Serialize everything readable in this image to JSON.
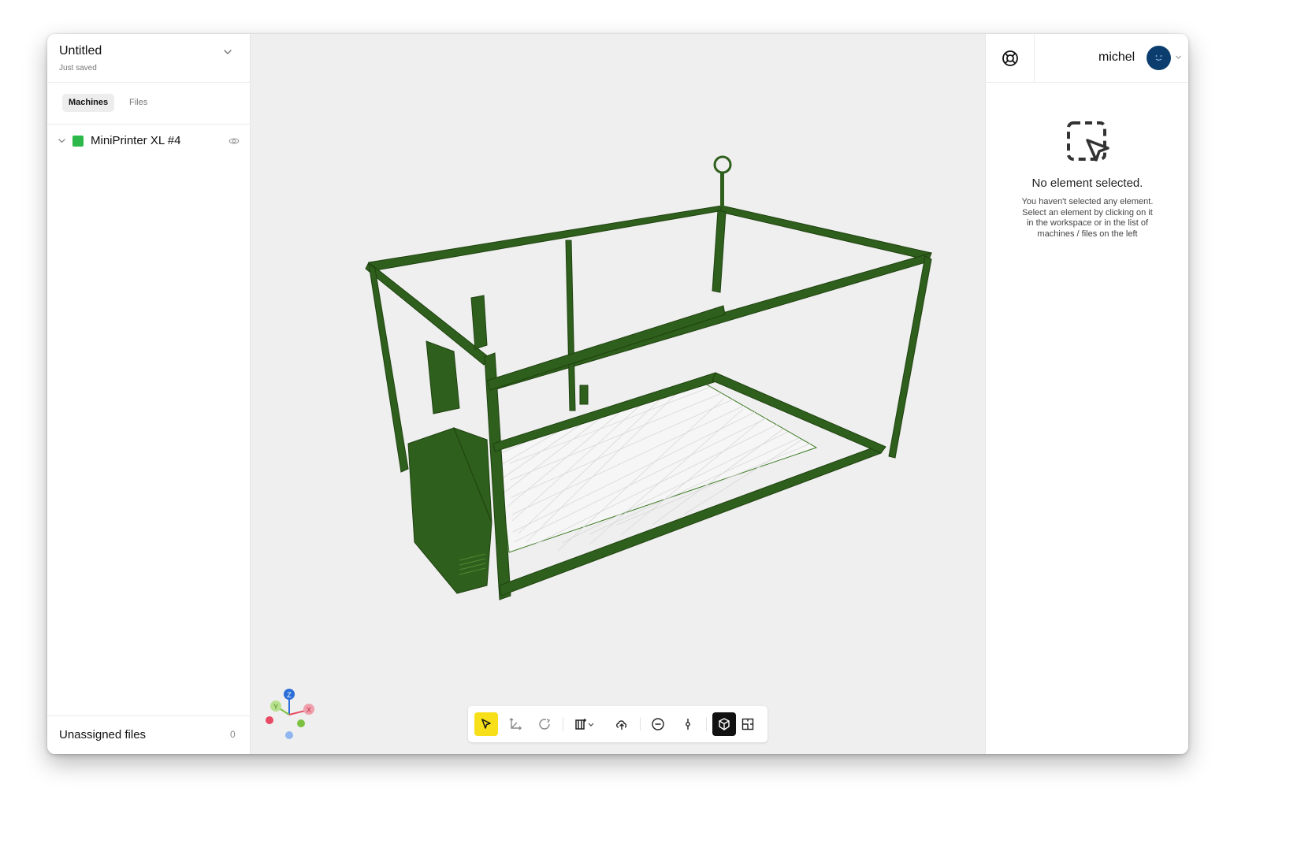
{
  "document": {
    "title": "Untitled",
    "status": "Just saved"
  },
  "left_panel": {
    "tabs": [
      {
        "label": "Machines",
        "active": true
      },
      {
        "label": "Files",
        "active": false
      }
    ],
    "machines": [
      {
        "name": "MiniPrinter XL #4",
        "color": "#2db84a",
        "visible": true
      }
    ],
    "unassigned": {
      "label": "Unassigned files",
      "count": "0"
    }
  },
  "viewport": {
    "axis_gizmo": {
      "x": "X",
      "y": "Y",
      "z": "Z"
    },
    "model_color": "#2f5f1c",
    "toolbar": [
      {
        "icon": "select-pointer-icon",
        "active": true
      },
      {
        "icon": "move-axes-icon",
        "active": false
      },
      {
        "icon": "rotate-icon",
        "active": false
      },
      {
        "icon": "machine-add-icon",
        "active": false,
        "has_dropdown": true
      },
      {
        "icon": "cloud-upload-icon",
        "active": false
      },
      {
        "icon": "minus-circle-icon",
        "active": false
      },
      {
        "icon": "split-point-icon",
        "active": false
      },
      {
        "icon": "3d-view-cube-icon",
        "active": true
      },
      {
        "icon": "2d-view-icon",
        "active": false
      }
    ]
  },
  "right_panel": {
    "user": {
      "name": "michel",
      "avatar_color": "#0b3e6e"
    },
    "empty_state": {
      "title": "No element selected.",
      "body": "You haven't selected any element. Select an element by clicking on it in the workspace or in the list of machines / files on the left"
    }
  },
  "colors": {
    "accent_yellow": "#f7df1a",
    "machine_green": "#2db84a",
    "panel_bg": "#ffffff",
    "viewport_bg": "#efefef"
  }
}
